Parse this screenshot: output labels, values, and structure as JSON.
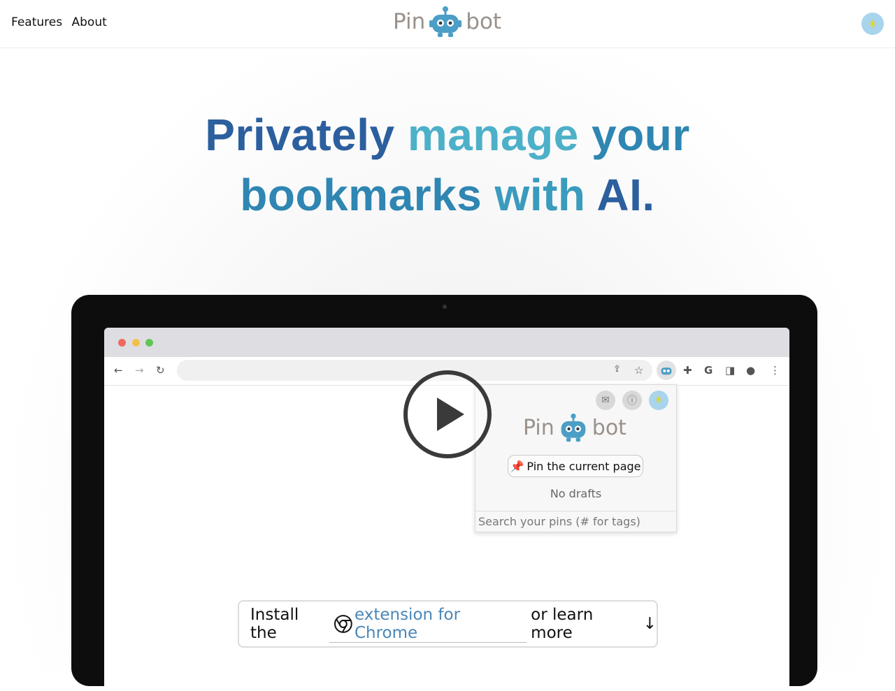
{
  "header": {
    "nav": [
      {
        "label": "Features"
      },
      {
        "label": "About"
      }
    ],
    "brand": {
      "left": "Pin",
      "right": "bot"
    },
    "theme_toggle_icon": "sun-icon"
  },
  "hero": {
    "line1a": "Privately",
    "line1b": "manage",
    "line1c": "your",
    "line2a": "bookmarks",
    "line2b": "with",
    "line2c": "AI."
  },
  "browser_mock": {
    "popup": {
      "brand": {
        "left": "Pin",
        "right": "bot"
      },
      "pin_button_label": "Pin the current page",
      "drafts_text": "No drafts",
      "search_placeholder": "Search your pins (# for tags)"
    }
  },
  "cta": {
    "prefix": "Install the",
    "link_text": "extension for Chrome",
    "suffix": "or learn more",
    "arrow": "↓"
  },
  "colors": {
    "headline_dark_blue": "#2c5f9e",
    "headline_teal": "#4db0c9",
    "link_blue": "#4a87b8",
    "toggle_bg": "#a8d4ec",
    "brand_gray": "#9a918b"
  }
}
